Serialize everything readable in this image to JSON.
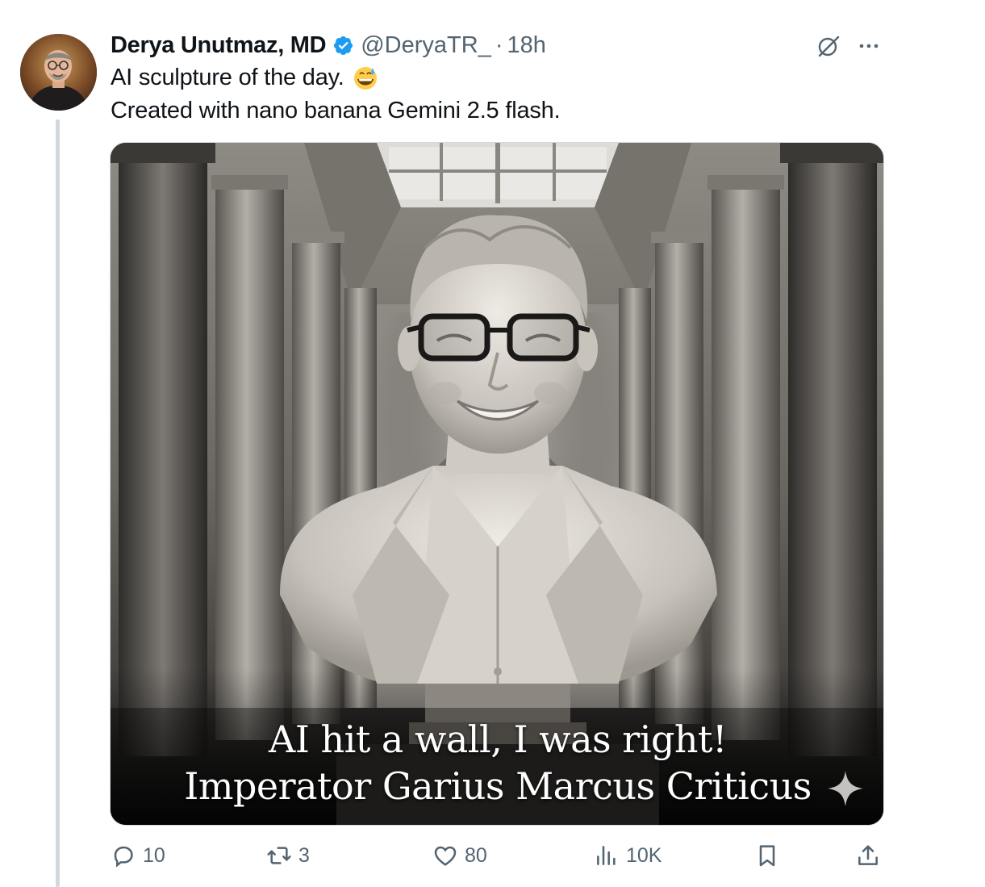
{
  "tweet": {
    "display_name": "Derya Unutmaz, MD",
    "handle": "@DeryaTR_",
    "separator": "·",
    "time": "18h",
    "text_line1": "AI sculpture of the day.",
    "text_line2": "Created with nano banana Gemini 2.5 flash.",
    "emoji": "grinning-face-with-sweat"
  },
  "media": {
    "caption_line1": "AI hit a wall, I was right!",
    "caption_line2": "Imperator Garius Marcus Criticus"
  },
  "actions": {
    "replies": "10",
    "reposts": "3",
    "likes": "80",
    "views": "10K"
  },
  "colors": {
    "verified": "#1d9bf0",
    "muted": "#536471",
    "thread_line": "#cfd9de"
  }
}
